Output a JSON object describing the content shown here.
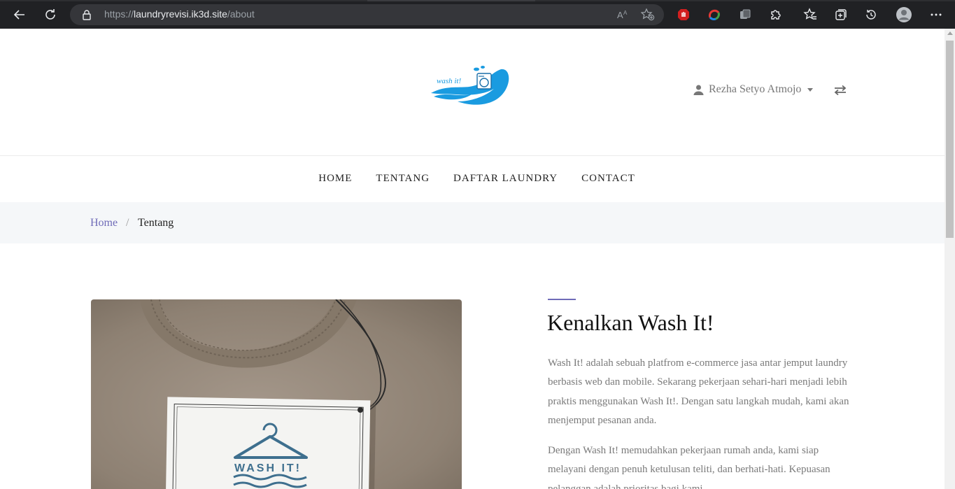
{
  "browser": {
    "url_prefix": "https://",
    "url_host": "laundryrevisi.ik3d.site",
    "url_path": "/about"
  },
  "header": {
    "logo_text": "wash it!",
    "user_name": "Rezha Setyo Atmojo"
  },
  "nav": {
    "items": [
      "HOME",
      "TENTANG",
      "DAFTAR LAUNDRY",
      "CONTACT"
    ]
  },
  "breadcrumb": {
    "home": "Home",
    "separator": "/",
    "current": "Tentang"
  },
  "about": {
    "title": "Kenalkan Wash It!",
    "paragraph1": "Wash It! adalah sebuah platfrom e-commerce jasa antar jemput laundry berbasis web dan mobile. Sekarang pekerjaan sehari-hari menjadi lebih praktis menggunakan Wash It!. Dengan satu langkah mudah, kami akan menjemput pesanan anda.",
    "paragraph2": "Dengan Wash It! memudahkan pekerjaan rumah anda, kami siap melayani dengan penuh ketulusan teliti, dan berhati-hati. Kepuasan pelanggan adalah prioritas bagi kami."
  },
  "photo": {
    "tag_text": "WASH IT!"
  },
  "colors": {
    "accent": "#6f6bb8",
    "brand_blue": "#1a9be0",
    "chrome_bg": "#202124"
  },
  "icons": [
    "back-icon",
    "reload-icon",
    "lock-icon",
    "read-aloud-icon",
    "add-favorite-icon",
    "adblock-icon",
    "color-extension-icon",
    "collections-extension-icon",
    "extensions-icon",
    "favorites-icon",
    "collections-icon",
    "history-icon",
    "profile-icon",
    "more-icon",
    "user-icon",
    "swap-icon"
  ]
}
